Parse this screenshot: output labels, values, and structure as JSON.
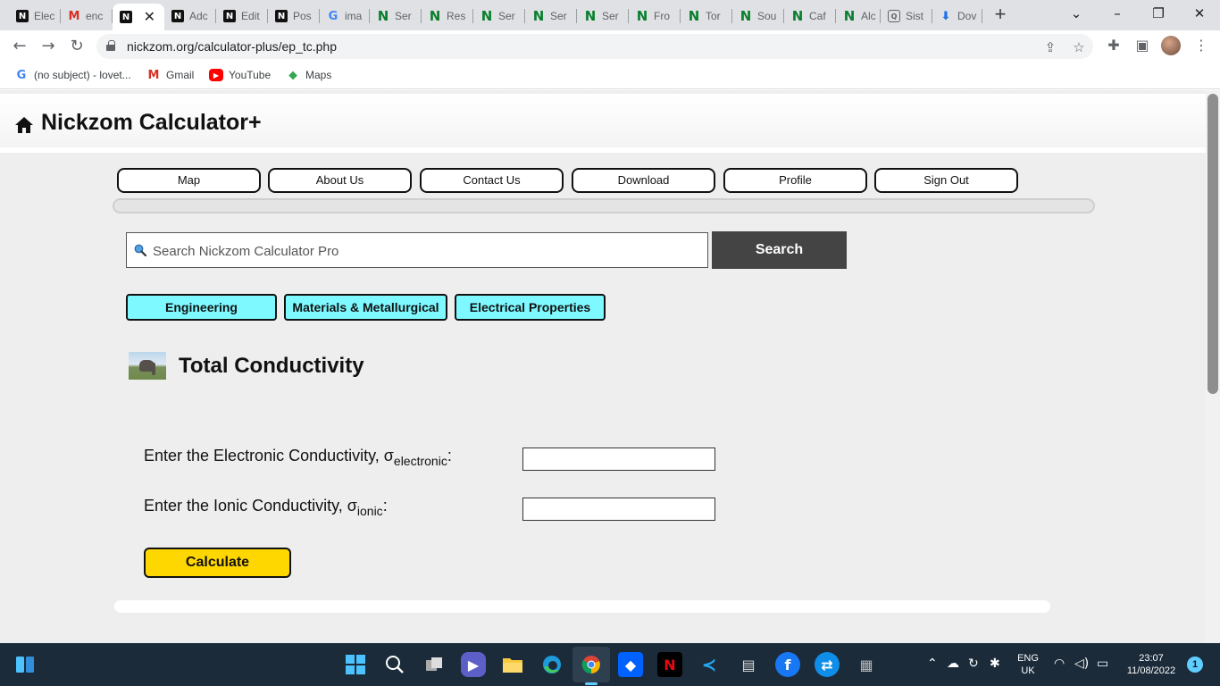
{
  "browser": {
    "tabs": [
      {
        "label": "Elec",
        "favicon": "nickzom"
      },
      {
        "label": "enc",
        "favicon": "gmail"
      },
      {
        "label": "",
        "favicon": "nickzom",
        "active": true
      },
      {
        "label": "Adc",
        "favicon": "nickzom"
      },
      {
        "label": "Edit",
        "favicon": "nickzom"
      },
      {
        "label": "Pos",
        "favicon": "nickzom"
      },
      {
        "label": "ima",
        "favicon": "google"
      },
      {
        "label": "Ser",
        "favicon": "n-green"
      },
      {
        "label": "Res",
        "favicon": "n-green"
      },
      {
        "label": "Ser",
        "favicon": "n-green"
      },
      {
        "label": "Ser",
        "favicon": "n-green"
      },
      {
        "label": "Ser",
        "favicon": "n-green"
      },
      {
        "label": "Fro",
        "favicon": "n-green"
      },
      {
        "label": "Tor",
        "favicon": "n-green"
      },
      {
        "label": "Sou",
        "favicon": "n-green"
      },
      {
        "label": "Caf",
        "favicon": "n-green"
      },
      {
        "label": "Alc",
        "favicon": "n-green"
      },
      {
        "label": "Sist",
        "favicon": "box"
      },
      {
        "label": "Dov",
        "favicon": "download"
      }
    ],
    "url": "nickzom.org/calculator-plus/ep_tc.php",
    "bookmarks": [
      {
        "label": "(no subject) - lovet...",
        "icon": "google-icon"
      },
      {
        "label": "Gmail",
        "icon": "gmail-icon"
      },
      {
        "label": "YouTube",
        "icon": "youtube-icon"
      },
      {
        "label": "Maps",
        "icon": "maps-icon"
      }
    ]
  },
  "site": {
    "title": "Nickzom Calculator+",
    "menu": [
      "Map",
      "About Us",
      "Contact Us",
      "Download",
      "Profile",
      "Sign Out"
    ],
    "search": {
      "placeholder": "Search Nickzom Calculator Pro",
      "button": "Search"
    },
    "breadcrumbs": [
      "Engineering",
      "Materials & Metallurgical",
      "Electrical Properties"
    ],
    "calculator": {
      "title": "Total Conductivity",
      "fields": [
        {
          "label": "Enter the Electronic Conductivity, σ",
          "sub": "electronic",
          "suffix": ":",
          "value": ""
        },
        {
          "label": "Enter the Ionic Conductivity, σ",
          "sub": "ionic",
          "suffix": ":",
          "value": ""
        }
      ],
      "button": "Calculate"
    }
  },
  "taskbar": {
    "language": "ENG",
    "region": "UK",
    "time": "23:07",
    "date": "11/08/2022",
    "notifications": "1"
  }
}
